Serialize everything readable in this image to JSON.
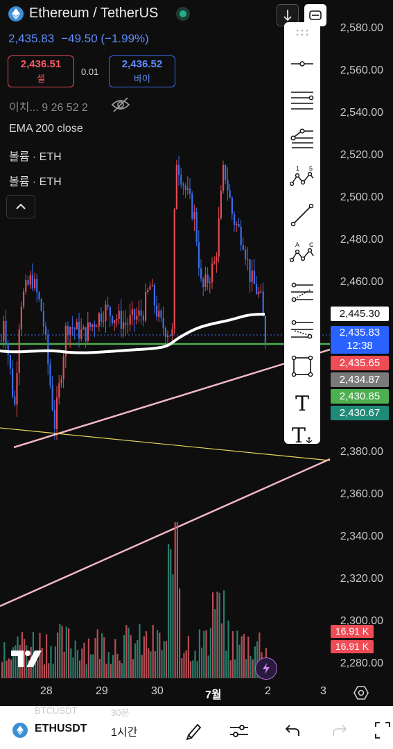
{
  "header": {
    "symbol_title": "Ethereum / TetherUS",
    "last_price": "2,435.83",
    "change": "−49.50 (−1.99%)",
    "sell_price": "2,436.51",
    "sell_label": "셀",
    "spread": "0.01",
    "buy_price": "2,436.52",
    "buy_label": "바이",
    "ichimoku": "이치...  9 26 52 2",
    "ema": "EMA 200 close",
    "volume1": "볼륨 · ETH",
    "volume2": "볼륨 · ETH"
  },
  "colors": {
    "up": "#e84a53",
    "down": "#3a6ee8",
    "ema": "#ffffff",
    "green_line": "#4caf50",
    "trendline": "#f4b8c8",
    "yellow_line": "#e8d25a",
    "vol_up": "#2e8a78",
    "vol_down": "#c9545c"
  },
  "y_axis": [
    "2,580.00",
    "2,560.00",
    "2,540.00",
    "2,520.00",
    "2,500.00",
    "2,480.00",
    "2,460.00",
    "2,380.00",
    "2,360.00",
    "2,340.00",
    "2,320.00",
    "2,300.00",
    "2,280.00"
  ],
  "price_labels": [
    {
      "text": "2,445.30",
      "bg": "#ffffff",
      "fg": "#111111"
    },
    {
      "text": "2,435.83",
      "bg": "#2962ff",
      "fg": "#ffffff"
    },
    {
      "text": "12:38",
      "bg": "#2962ff",
      "fg": "#ffffff"
    },
    {
      "text": "2,435.65",
      "bg": "#ef4c55",
      "fg": "#ffffff"
    },
    {
      "text": "2,434.87",
      "bg": "#7a7a7a",
      "fg": "#ffffff"
    },
    {
      "text": "2,430.85",
      "bg": "#4caf50",
      "fg": "#ffffff"
    },
    {
      "text": "2,430.67",
      "bg": "#1f8a78",
      "fg": "#ffffff"
    }
  ],
  "volume_tags": [
    "16.91 K",
    "16.91 K"
  ],
  "x_axis": [
    "28",
    "29",
    "30",
    "7월",
    "2",
    "3"
  ],
  "toolbar": {
    "items": [
      "drag-handle-icon",
      "horizontal-ray-icon",
      "parallel-channel-icon",
      "pitchfork-icon",
      "elliott-wave-icon",
      "trendline-icon",
      "abcd-pattern-icon",
      "fib-retracement-icon",
      "fib-extension-icon",
      "rectangle-icon",
      "text-icon",
      "anchored-text-icon"
    ],
    "wave_labels": [
      "1",
      "5"
    ],
    "abc_labels": [
      "A",
      "C"
    ],
    "text_glyph": "T"
  },
  "bottom": {
    "ticker": "ETHUSDT",
    "interval": "1시간",
    "ghost_left": "BTCUSDT",
    "ghost_right": "30분"
  },
  "tv_logo": "TV"
}
